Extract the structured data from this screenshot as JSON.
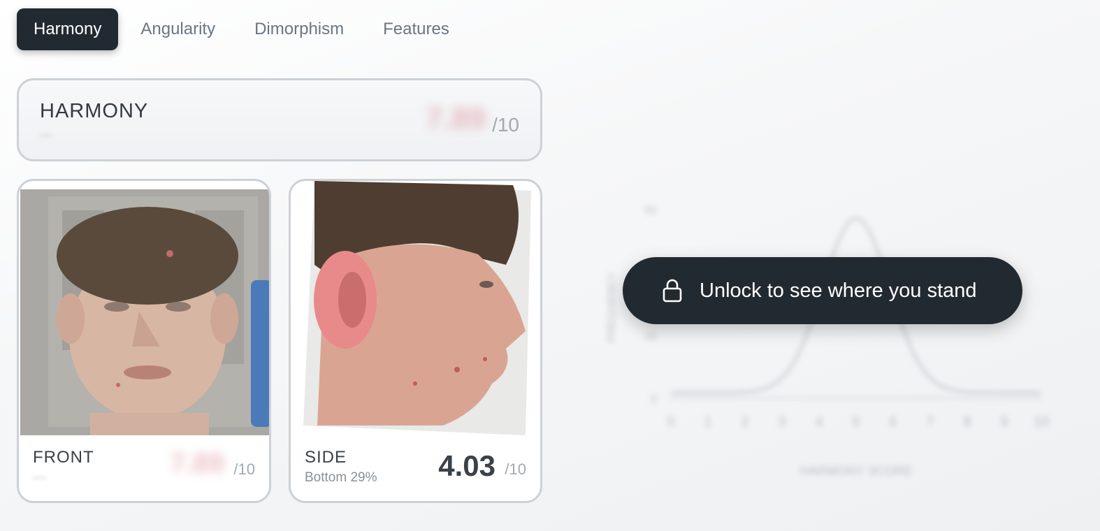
{
  "tabs": [
    {
      "label": "Harmony",
      "active": true
    },
    {
      "label": "Angularity",
      "active": false
    },
    {
      "label": "Dimorphism",
      "active": false
    },
    {
      "label": "Features",
      "active": false
    }
  ],
  "harmony_card": {
    "title": "HARMONY",
    "rank": "—",
    "score": "7.89",
    "denominator": "/10"
  },
  "photos": {
    "front": {
      "label": "FRONT",
      "rank": "—",
      "score": "7.89",
      "denominator": "/10"
    },
    "side": {
      "label": "SIDE",
      "rank": "Bottom 29%",
      "score": "4.03",
      "denominator": "/10"
    }
  },
  "chart": {
    "x_ticks": [
      "0",
      "1",
      "2",
      "3",
      "4",
      "5",
      "6",
      "7",
      "8",
      "9",
      "10"
    ],
    "y_ticks": [
      "0",
      "20",
      "40",
      "60"
    ],
    "xlabel": "HARMONY SCORE",
    "ylabel": "FREQUENCY"
  },
  "unlock": {
    "label": "Unlock to see where you stand",
    "icon": "lock-icon"
  },
  "colors": {
    "accent_dark": "#222a31",
    "blur_score": "#c94c5a"
  }
}
